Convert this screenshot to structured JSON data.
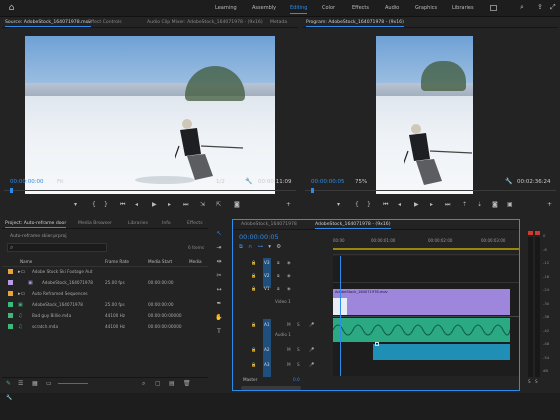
{
  "workspaces": [
    "Learning",
    "Assembly",
    "Editing",
    "Color",
    "Effects",
    "Audio",
    "Graphics",
    "Libraries"
  ],
  "active_workspace": "Editing",
  "source": {
    "tabs": [
      "Source: AdobeStock_164071978.mov",
      "Effect Controls",
      "Audio Clip Mixer: AdobeStock_164071978 - (9x16)",
      "Metada"
    ],
    "timecode_in": "00:00:00:00",
    "fit": "Fit",
    "resolution": "1/2",
    "timecode_out": "00:00:11:09"
  },
  "program": {
    "tab": "Program: AdobeStock_164071978 - (9x16)",
    "timecode_in": "00:00:00:05",
    "zoom": "75%",
    "timecode_out": "00:02:36:24"
  },
  "project": {
    "tabs": [
      "Project: Auto-reframe door",
      "Media Browser",
      "Libraries",
      "Info",
      "Effects"
    ],
    "folder": "Auto-reframe skier.prproj",
    "items_count": "6 Items",
    "columns": [
      "Name",
      "Frame Rate",
      "Media Start",
      "Media"
    ],
    "rows": [
      {
        "name": "Adobe Stock Ski Footage Aut",
        "fps": "",
        "start": "",
        "color": "#e8a33a",
        "indent": 0,
        "kind": "folder"
      },
      {
        "name": "AdobeStock_164071978",
        "fps": "25.00 fps",
        "start": "00:00:00:00",
        "color": "#b69be8",
        "indent": 1,
        "kind": "seq"
      },
      {
        "name": "Auto Reframed Sequences",
        "fps": "",
        "start": "",
        "color": "#e8a33a",
        "indent": 0,
        "kind": "folder"
      },
      {
        "name": "AdobeStock_164071978",
        "fps": "25.00 fps",
        "start": "00:00:00:00",
        "color": "#3fb87e",
        "indent": 0,
        "kind": "clip"
      },
      {
        "name": "Bad guy Billie.m4a",
        "fps": "44100 Hz",
        "start": "00:00:00:00000",
        "color": "#3fb87e",
        "indent": 0,
        "kind": "audio"
      },
      {
        "name": "scratch.m4a",
        "fps": "44100 Hz",
        "start": "00:00:00:00000",
        "color": "#3fb87e",
        "indent": 0,
        "kind": "audio"
      }
    ]
  },
  "timeline": {
    "tabs": [
      "AdobeStock_164071978",
      "AdobeStock_164071978 - (9x16)"
    ],
    "timecode": "00:00:00:05",
    "ruler": [
      "00:00",
      "00:00:01:00",
      "00:00:02:00",
      "00:00:03:00"
    ],
    "video_tracks": [
      "V3",
      "V2",
      "V1"
    ],
    "video1_label": "Video 1",
    "audio_tracks": [
      "A1",
      "A2",
      "A3"
    ],
    "audio1_label": "Audio 1",
    "master_label": "Master",
    "master_value": "0.0",
    "video_clip_label": "AdobeStock_164071978.mov",
    "playhead_percent": 4
  },
  "meter": {
    "labels": [
      "0",
      "-6",
      "-12",
      "-18",
      "-24",
      "-30",
      "-36",
      "-42",
      "-48",
      "-54",
      "dB"
    ],
    "solo": [
      "S",
      "S"
    ]
  },
  "colors": {
    "accent": "#2d8ceb",
    "video_clip": "#9f86dd",
    "audio_clip": "#2aa982",
    "audio_clip2": "#1f8fb5"
  }
}
